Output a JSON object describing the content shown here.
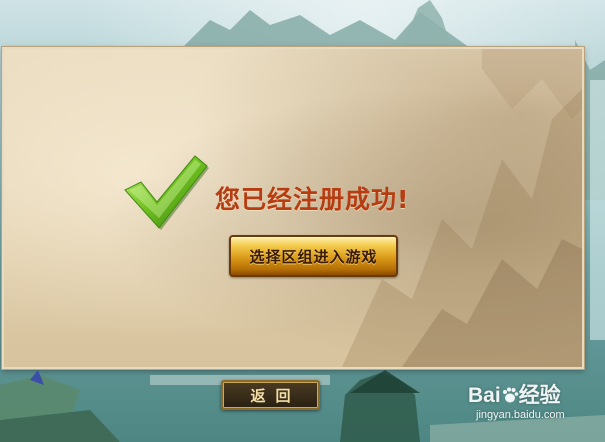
{
  "colors": {
    "title": "#b63c12",
    "button_gold": "#d99a18",
    "back_text": "#f3dfa6",
    "check_green": "#6fbf1f"
  },
  "panel": {
    "icon": "check-icon",
    "title": "您已经注册成功!",
    "enter_button_label": "选择区组进入游戏"
  },
  "footer": {
    "back_button_label": "返回"
  },
  "watermark": {
    "brand_left": "Bai",
    "brand_right": "经验",
    "site": "jingyan.baidu.com",
    "icon": "paw-icon"
  }
}
